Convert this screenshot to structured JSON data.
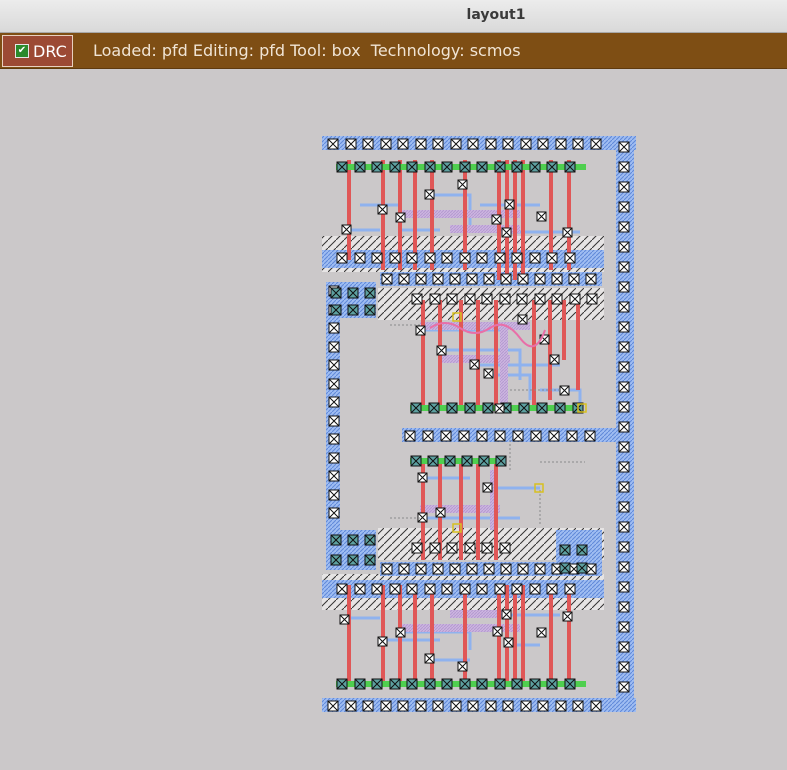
{
  "window": {
    "title": "layout1"
  },
  "toolbar": {
    "drc_label": "DRC",
    "drc_checked": true,
    "status": "Loaded: pfd Editing: pfd Tool: box  Technology: scmos"
  },
  "colors": {
    "background": "#cbc8c9",
    "statusbar": "#7e4e14",
    "metal1": "#8fb2ee",
    "poly": "#e05757",
    "ndiff": "#4fcf4f",
    "metal2": "#c9b3d9",
    "contact_fill": "#5da0a0"
  },
  "layout": {
    "cell": "pfd",
    "layers": [
      "metal1",
      "metal2",
      "poly",
      "ndiffusion",
      "pdiffusion",
      "contact",
      "well"
    ]
  }
}
